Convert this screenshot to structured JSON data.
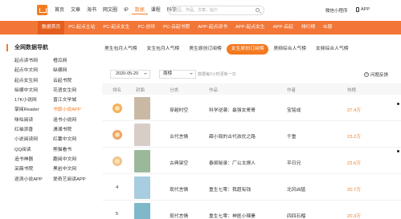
{
  "topbar": {
    "nav": [
      "首页",
      "文章",
      "海书",
      "网文圈",
      "IP",
      "数据",
      "课程",
      "码字"
    ],
    "active_index": 5,
    "search_placeholder": "社区、作品、文章、帖户",
    "wechat_label": "微信小程序",
    "app_label": "APP"
  },
  "orange_nav": {
    "items": [
      "数据首页",
      "PC-起点主站",
      "PC-起点女生",
      "PC-创世",
      "PC-云起书院",
      "APP-起点读书",
      "APP-起点女生",
      "APP-云起",
      "排行榜",
      "IE版"
    ],
    "active_index": 0
  },
  "sidebar": {
    "title": "全网数据导航",
    "items": [
      "起点读书网",
      "橙瓜网",
      "起点中文网",
      "纵横网",
      "起点女生网",
      "云起书院",
      "纵横中文网",
      "花语女生网",
      "17K小说网",
      "晋江文学城",
      "掌阅Reader",
      "书旗小说APP",
      "咪咕阅读",
      "追书小说网",
      "红袖添香",
      "潇湘书院",
      "小说阅读网",
      "红薯中文网",
      "QQ阅读",
      "熊猫看书",
      "追书神器",
      "趣阅中文网",
      "采薇书院",
      "黑岩中文网",
      "逐浪小说APP",
      "爱奇艺阅读APP"
    ],
    "active_index": 11
  },
  "tabs": {
    "items": [
      "男生包月人气榜",
      "女生包月人气榜",
      "男生原创订阅榜",
      "女生原创订阅榜",
      "男频综合人气榜",
      "女频综合人气榜"
    ],
    "active_index": 3
  },
  "filter": {
    "date": "2020-05-20",
    "period": "周榜",
    "note": "数据每2小时更新一次",
    "feedback": "问题反馈"
  },
  "table": {
    "headers": [
      "排名",
      "封面",
      "分类",
      "作品",
      "作者",
      "热榜"
    ],
    "rows": [
      {
        "rank": "1",
        "category": "穿越时空",
        "title": "科学逆袭：最强女哥哥",
        "author": "宝铭成",
        "hot": "27.4万",
        "cover_color": "#c9b9a4"
      },
      {
        "rank": "2",
        "category": "古代言情",
        "title": "薛小局的古代孩优之路",
        "author": "千重",
        "hot": "23.2万",
        "cover_color": "#d9cdc7"
      },
      {
        "rank": "3",
        "category": "古典架空",
        "title": "春闺秘录：厂公太撩人",
        "author": "平日兄",
        "hot": "22.6万",
        "cover_color": "#9bb99a"
      },
      {
        "rank": "4",
        "category": "现代言情",
        "title": "重生七零：我超有钱",
        "author": "北风凶猛",
        "hot": "20.7万",
        "cover_color": "#a8cce0"
      },
      {
        "rank": "5",
        "category": "现代言情",
        "title": "重生七零：神医小辣妻",
        "author": "四四石榴",
        "hot": "20.3万",
        "cover_color": "#7fb8c8"
      }
    ]
  },
  "colors": {
    "brand_orange": "#f27637",
    "accent": "#f47a20"
  }
}
